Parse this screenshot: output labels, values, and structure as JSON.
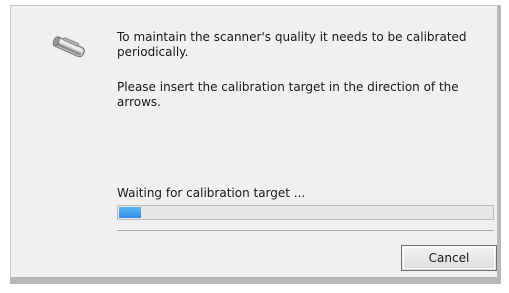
{
  "dialog": {
    "message_quality": "To maintain the scanner's quality it needs to be calibrated periodically.",
    "message_insert": "Please insert the calibration target in the direction of the arrows.",
    "status_text": "Waiting for calibration target ...",
    "progress_fraction": 0.06,
    "cancel_label": "Cancel",
    "icon": "scanner-icon",
    "progress_color": "#2f8ee6"
  }
}
